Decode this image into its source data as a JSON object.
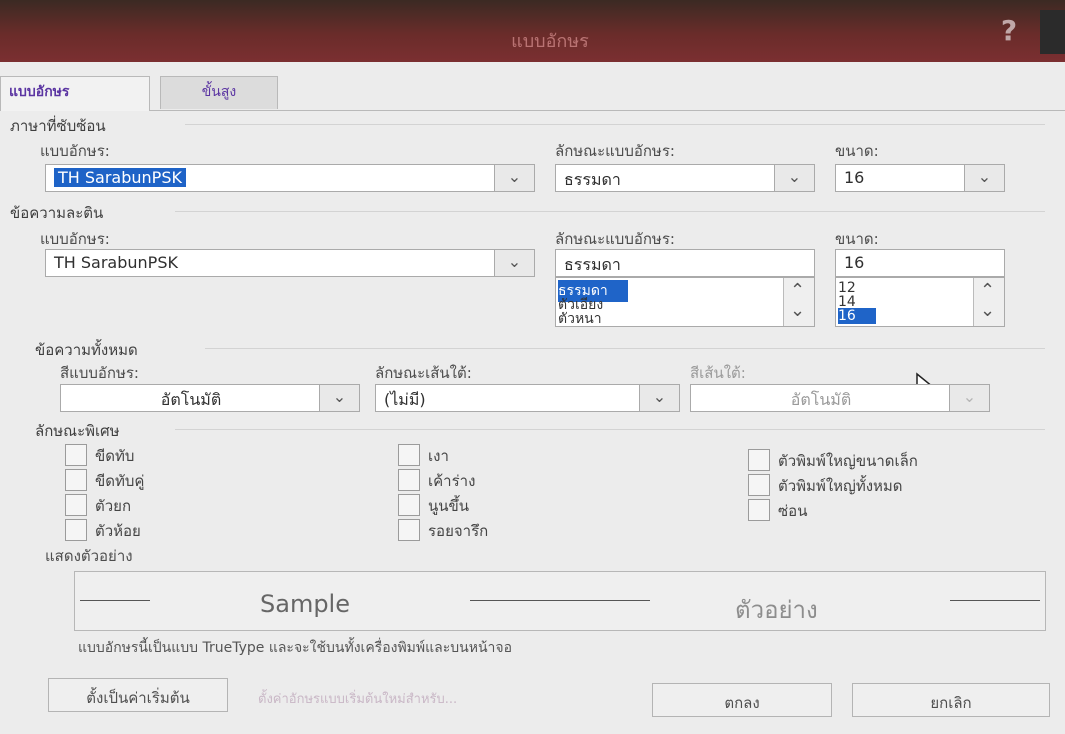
{
  "window": {
    "title": "แบบอักษร",
    "help_glyph": "?"
  },
  "tabs": [
    {
      "label": "แบบอักษร"
    },
    {
      "label": "ขั้นสูง"
    }
  ],
  "sections": {
    "complex": {
      "title": "ภาษาที่ซับซ้อน",
      "font_label": "แบบอักษร:",
      "font_value": "TH SarabunPSK",
      "style_label": "ลักษณะแบบอักษร:",
      "style_value": "ธรรมดา",
      "size_label": "ขนาด:",
      "size_value": "16"
    },
    "latin": {
      "title": "ข้อความละติน",
      "font_label": "แบบอักษร:",
      "font_value": "TH SarabunPSK",
      "style_label": "ลักษณะแบบอักษร:",
      "style_value": "ธรรมดา",
      "style_options": [
        "ธรรมดา",
        "ตัวเอียง",
        "ตัวหนา"
      ],
      "size_label": "ขนาด:",
      "size_value": "16",
      "size_options": [
        "12",
        "14",
        "16"
      ]
    },
    "all_text": {
      "title": "ข้อความทั้งหมด",
      "font_color_label": "สีแบบอักษร:",
      "font_color_value": "อัตโนมัติ",
      "underline_style_label": "ลักษณะเส้นใต้:",
      "underline_style_value": "(ไม่มี)",
      "underline_color_label": "สีเส้นใต้:",
      "underline_color_value": "อัตโนมัติ"
    },
    "effects": {
      "title": "ลักษณะพิเศษ",
      "items": [
        "ขีดทับ",
        "ขีดทับคู่",
        "ตัวยก",
        "ตัวห้อย",
        "เงา",
        "เค้าร่าง",
        "นูนขึ้น",
        "รอยจารึก",
        "ตัวพิมพ์ใหญ่ขนาดเล็ก",
        "ตัวพิมพ์ใหญ่ทั้งหมด",
        "ซ่อน"
      ]
    },
    "preview": {
      "title": "แสดงตัวอย่าง",
      "sample_latin": "Sample",
      "sample_thai": "ตัวอย่าง",
      "description": "แบบอักษรนี้เป็นแบบ TrueType และจะใช้บนทั้งเครื่องพิมพ์และบนหน้าจอ"
    }
  },
  "footer": {
    "default_button": "ตั้งเป็นค่าเริ่มต้น",
    "faint_label": "ตั้งค่าอักษรแบบเริ่มต้นใหม่สำหรับ...",
    "ok_button": "ตกลง",
    "cancel_button": "ยกเลิก"
  }
}
